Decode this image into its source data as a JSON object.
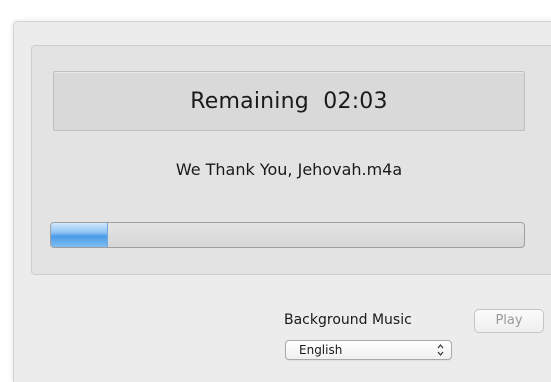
{
  "player": {
    "remaining_label": "Remaining",
    "remaining_time": "02:03",
    "track_name": "We Thank You, Jehovah.m4a",
    "progress_fraction": 0.12
  },
  "background_music": {
    "label": "Background Music",
    "play_label": "Play",
    "play_enabled": false,
    "language_selected": "English",
    "select_icon": "updown-arrows-icon"
  },
  "colors": {
    "progress_fill": "#4a9be8",
    "window_bg": "#ececec"
  }
}
